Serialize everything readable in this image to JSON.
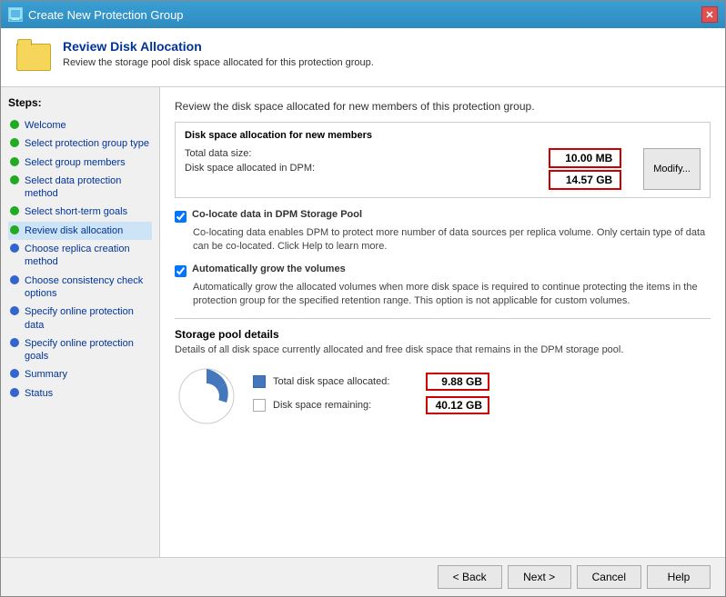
{
  "titleBar": {
    "title": "Create New Protection Group",
    "closeLabel": "✕",
    "iconText": "🖥"
  },
  "header": {
    "title": "Review Disk Allocation",
    "description": "Review the storage pool disk space allocated for this protection group."
  },
  "sidebar": {
    "stepsLabel": "Steps:",
    "items": [
      {
        "id": "welcome",
        "label": "Welcome",
        "dot": "green",
        "active": false
      },
      {
        "id": "select-protection-group-type",
        "label": "Select protection group type",
        "dot": "green",
        "active": false
      },
      {
        "id": "select-group-members",
        "label": "Select group members",
        "dot": "green",
        "active": false
      },
      {
        "id": "select-data-protection-method",
        "label": "Select data protection method",
        "dot": "green",
        "active": false
      },
      {
        "id": "select-short-term-goals",
        "label": "Select short-term goals",
        "dot": "green",
        "active": false
      },
      {
        "id": "review-disk-allocation",
        "label": "Review disk allocation",
        "dot": "green",
        "active": true
      },
      {
        "id": "choose-replica-creation-method",
        "label": "Choose replica creation method",
        "dot": "blue",
        "active": false
      },
      {
        "id": "choose-consistency-check-options",
        "label": "Choose consistency check options",
        "dot": "blue",
        "active": false
      },
      {
        "id": "specify-online-protection-data",
        "label": "Specify online protection data",
        "dot": "blue",
        "active": false
      },
      {
        "id": "specify-online-protection-goals",
        "label": "Specify online protection goals",
        "dot": "blue",
        "active": false
      },
      {
        "id": "summary",
        "label": "Summary",
        "dot": "blue",
        "active": false
      },
      {
        "id": "status",
        "label": "Status",
        "dot": "blue",
        "active": false
      }
    ]
  },
  "content": {
    "introText": "Review the disk space allocated for new members of this protection group.",
    "diskAllocation": {
      "title": "Disk space allocation for new members",
      "totalDataLabel": "Total data size:",
      "totalDataValue": "10.00 MB",
      "diskSpaceLabel": "Disk space allocated in DPM:",
      "diskSpaceValue": "14.57 GB",
      "modifyLabel": "Modify..."
    },
    "coLocate": {
      "label": "Co-locate data in DPM Storage Pool",
      "description": "Co-locating data enables DPM to protect more number of data sources per replica volume. Only certain type of data can be co-located. Click Help to learn more.",
      "checked": true
    },
    "autoGrow": {
      "label": "Automatically grow the volumes",
      "description": "Automatically grow the allocated volumes when more disk space is required to continue protecting the items in the protection group for the specified retention range. This option is not applicable for custom volumes.",
      "checked": true
    },
    "storagePool": {
      "title": "Storage pool details",
      "description": "Details of all disk space currently allocated and free disk space that remains in the DPM storage pool.",
      "allocatedLabel": "Total disk space allocated:",
      "allocatedValue": "9.88 GB",
      "remainingLabel": "Disk space remaining:",
      "remainingValue": "40.12 GB"
    }
  },
  "footer": {
    "backLabel": "< Back",
    "nextLabel": "Next >",
    "cancelLabel": "Cancel",
    "helpLabel": "Help"
  }
}
